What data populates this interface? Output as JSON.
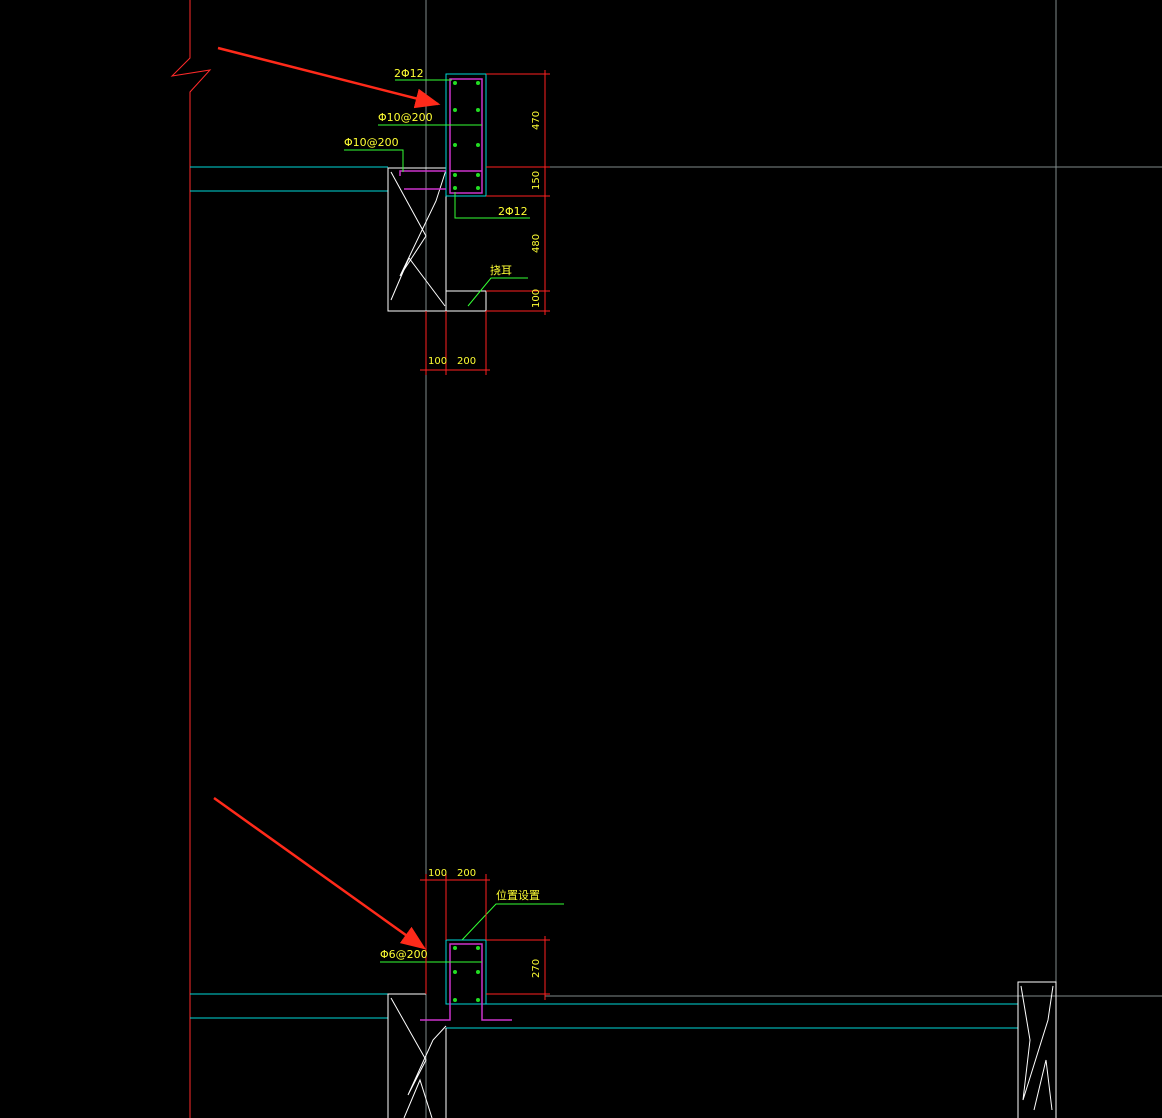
{
  "colors": {
    "background": "#000000",
    "grid": "#7f8a8a",
    "wall": "#ff2a2a",
    "slab": "#00d8d8",
    "stirrup": "#cc33cc",
    "rebar_dot": "#22dd22",
    "dimension": "#ff2020",
    "text": "#ffff33",
    "leader": "#33ff33",
    "outline": "#ffffff",
    "arrow": "#ff2a1a"
  },
  "upper_detail": {
    "labels": {
      "top_bars": "2Φ12",
      "stirrup": "Φ10@200",
      "slab_bar": "Φ10@200",
      "bottom_bars": "2Φ12",
      "note": "挠耳"
    },
    "dims": {
      "h1": "470",
      "h2": "150",
      "h3": "480",
      "h4": "100",
      "w1": "100",
      "w2": "200"
    }
  },
  "lower_detail": {
    "labels": {
      "note": "位置设置",
      "stirrup": "Φ6@200"
    },
    "dims": {
      "w1": "100",
      "w2": "200",
      "h1": "270"
    }
  }
}
